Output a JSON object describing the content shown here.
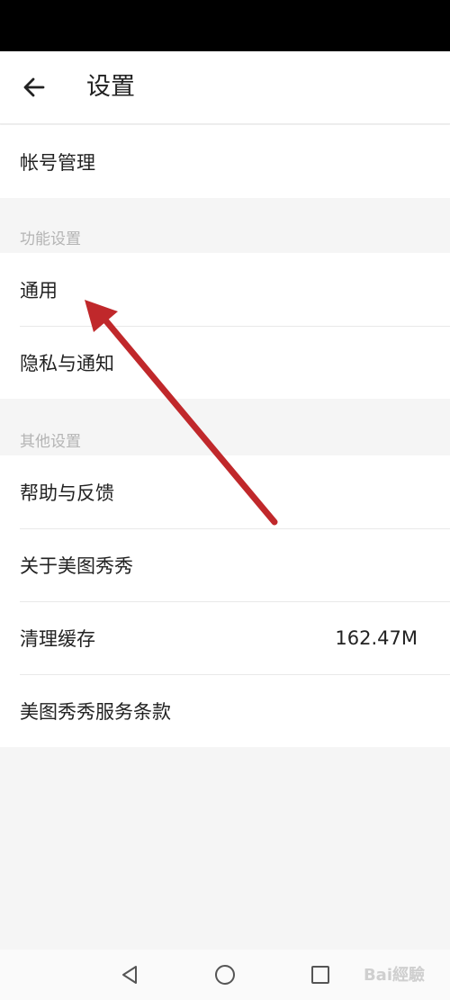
{
  "header": {
    "title": "设置",
    "back_icon": "arrow-left-icon"
  },
  "section_account": {
    "items": [
      {
        "label": "帐号管理"
      }
    ]
  },
  "group_function": {
    "title": "功能设置",
    "items": [
      {
        "label": "通用"
      },
      {
        "label": "隐私与通知"
      }
    ]
  },
  "group_other": {
    "title": "其他设置",
    "items": [
      {
        "label": "帮助与反馈"
      },
      {
        "label": "关于美图秀秀"
      },
      {
        "label": "清理缓存",
        "value": "162.47M"
      },
      {
        "label": "美图秀秀服务条款"
      }
    ]
  },
  "nav": {
    "back_icon": "triangle-back-icon",
    "home_icon": "circle-home-icon",
    "recents_icon": "square-recents-icon"
  },
  "annotation": {
    "color": "#c0282b"
  },
  "watermark": {
    "text": "Bai經驗"
  }
}
